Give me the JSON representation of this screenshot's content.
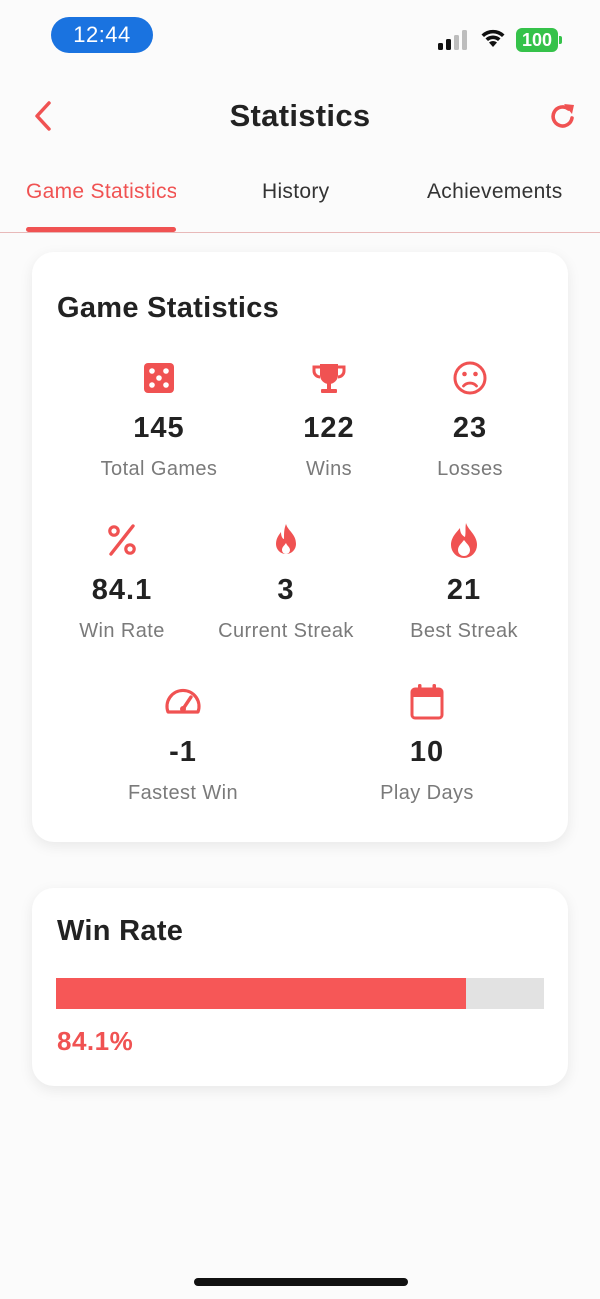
{
  "status_bar": {
    "time": "12:44",
    "battery": "100"
  },
  "header": {
    "title": "Statistics"
  },
  "tabs": [
    {
      "label": "Game Statistics",
      "active": true
    },
    {
      "label": "History",
      "active": false
    },
    {
      "label": "Achievements",
      "active": false
    }
  ],
  "game_stats": {
    "title": "Game Statistics",
    "items": [
      {
        "icon": "dice-icon",
        "value": "145",
        "label": "Total Games"
      },
      {
        "icon": "trophy-icon",
        "value": "122",
        "label": "Wins"
      },
      {
        "icon": "sad-face-icon",
        "value": "23",
        "label": "Losses"
      },
      {
        "icon": "percent-icon",
        "value": "84.1",
        "label": "Win Rate"
      },
      {
        "icon": "fire-icon",
        "value": "3",
        "label": "Current Streak"
      },
      {
        "icon": "flame-icon",
        "value": "21",
        "label": "Best Streak"
      },
      {
        "icon": "speedometer-icon",
        "value": "-1",
        "label": "Fastest Win"
      },
      {
        "icon": "calendar-icon",
        "value": "10",
        "label": "Play Days"
      }
    ]
  },
  "win_rate": {
    "title": "Win Rate",
    "percent": 84.1,
    "text": "84.1%"
  },
  "colors": {
    "accent": "#f05252",
    "progress_fill": "#f65757",
    "progress_track": "#e2e2e2",
    "time_pill": "#1a73e0",
    "battery": "#35c24a"
  }
}
